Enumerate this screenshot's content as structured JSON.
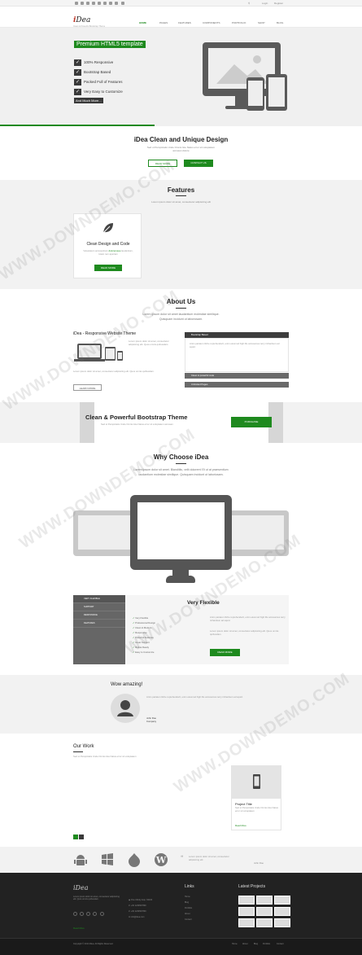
{
  "topbar": {
    "login": "Login",
    "register": "Register"
  },
  "header": {
    "logo_i": "i",
    "logo_rest": "Dea",
    "tagline": "Clean & Powerful Bootstrap Theme"
  },
  "nav": [
    "HOME",
    "PAGES",
    "FEATURES",
    "COMPONENTS",
    "PORTFOLIO",
    "SHOP",
    "BLOG"
  ],
  "hero": {
    "title": "Premium HTML5 template",
    "checks": [
      "100% Responsive",
      "Bootstrap Based",
      "Packed Full of Features",
      "Very Easy to Customize"
    ],
    "more": "And Much More..."
  },
  "intro": {
    "title": "iDea Clean and Unique Design",
    "text1": "Sed ut Perspiciatis Unde Omnis Iste Natus error sit voluptatem",
    "text2": "accusan dolore",
    "read_more": "READ MORE",
    "contact": "CONTACT US"
  },
  "features": {
    "title": "Features",
    "sub": "Lorem ipsum dolor sit amet, consectetur adipisicing elit",
    "card_title": "Clean Design and Code",
    "card_text1": "Voluptatem accusantium",
    "card_link": "doloremque",
    "card_text2": "laudantium, totam rem aperiam",
    "card_btn": "READ MORE"
  },
  "about": {
    "title": "About Us",
    "sub1": "Lorem ipsum dolor sit amet laudantium molestiae similique.",
    "sub2": "Quisquam incidunt ut laboriosam.",
    "left_title": "iDea - Responsive Website Theme",
    "left_text": "Lorem ipsum dolor sit amet, consectetur adipisicing elit. Quos omnis quibusdam.",
    "learn_more": "LEARN MORE",
    "acc1": "Bootstrap Based",
    "acc_text": "Anim pariatur cliche reprehenderit, enim eiusmod high life accusamus terry richardson ad squid.",
    "acc2": "Clean & powerful code",
    "acc3": "Unlimited Pages"
  },
  "cta": {
    "title": "Clean & Powerful Bootstrap Theme",
    "text": "Sed ut Perspiciatis Unde Omnis Iste Natus error sit voluptatem accusan",
    "button": "PURCHASE"
  },
  "why": {
    "title": "Why Choose iDea",
    "sub1": "Lorem ipsum dolor sit amet. Blanditiis, velit dolorem! Et ut at praesentium",
    "sub2": "laudantium molestiae similique. Quisquam incidunt ut laboriosam."
  },
  "flex": {
    "tabs": [
      "VERY FLEXIBLE",
      "SUPPORT",
      "RESPONSIVE",
      "FEATURES"
    ],
    "title": "Very Flexible",
    "list": [
      "Very Flexible",
      "Professional Design",
      "Clean & Modern",
      "Responsive",
      "Powerful Features",
      "Great Support",
      "Retina Ready",
      "Easy to Customize"
    ],
    "button": "READ MORE"
  },
  "testimonial": {
    "title": "Wow amazing!",
    "name": "John Doe",
    "company": "Company"
  },
  "work": {
    "title": "Our Work",
    "sub": "Sed ut Perspiciatis Unde Omnis Iste Natus error sit voluptatem",
    "project_title": "Project Title",
    "read_more": "Read More"
  },
  "footer": {
    "logo": "iDea",
    "read_more": "Read More",
    "address": "One infinity loop, 54100",
    "phone1": "+00 1234567890",
    "phone2": "+00 1234567890",
    "email": "info@idea.com",
    "links_title": "Links",
    "links": [
      "Home",
      "Blog",
      "Portfolio",
      "About",
      "Contact"
    ],
    "projects_title": "Latest Projects",
    "copyright": "Copyright © 2014 iDea. All Rights Reserved.",
    "bottom_links": [
      "Home",
      "About",
      "Blog",
      "Portfolio",
      "Contact"
    ]
  },
  "watermark": "WWW.DOWNDEMO.COM"
}
